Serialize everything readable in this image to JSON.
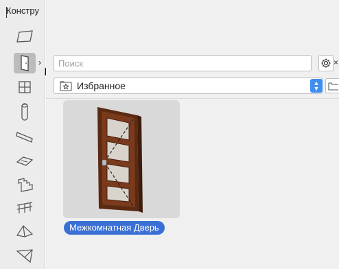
{
  "toolbox": {
    "title": "Констру",
    "tools": [
      {
        "name": "slab-tool",
        "icon": "parallelogram-icon"
      },
      {
        "name": "door-tool",
        "icon": "door-icon",
        "active": true
      },
      {
        "name": "window-tool",
        "icon": "window-icon"
      },
      {
        "name": "column-tool",
        "icon": "column-icon"
      },
      {
        "name": "beam-tool",
        "icon": "beam-icon"
      },
      {
        "name": "roof-tool",
        "icon": "roof-icon"
      },
      {
        "name": "stair-tool",
        "icon": "stair-icon"
      },
      {
        "name": "railing-tool",
        "icon": "railing-icon"
      },
      {
        "name": "shell-tool",
        "icon": "shell-icon"
      },
      {
        "name": "morph-tool",
        "icon": "morph-icon"
      }
    ],
    "expand_arrow": "›"
  },
  "search": {
    "placeholder": "Поиск",
    "close_glyph": "×"
  },
  "favorites": {
    "label": "Избранное"
  },
  "library": {
    "items": [
      {
        "label": "Межкомнатная Дверь",
        "selected": true
      }
    ]
  },
  "colors": {
    "accent": "#3a70d6",
    "stepper": "#3d8ef0",
    "door_frame": "#6b3418",
    "door_panel": "#7a3a1c",
    "door_glass": "#d8d4cc"
  }
}
